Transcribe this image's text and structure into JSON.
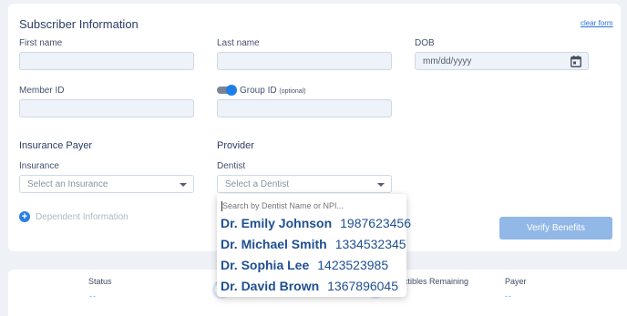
{
  "form": {
    "title": "Subscriber Information",
    "clear_label": "clear form",
    "first_name": {
      "label": "First name",
      "value": ""
    },
    "last_name": {
      "label": "Last name",
      "value": ""
    },
    "dob": {
      "label": "DOB",
      "placeholder": "mm/dd/yyyy"
    },
    "member_id": {
      "label": "Member ID",
      "value": ""
    },
    "group_id": {
      "label": "Group ID",
      "optional": "(optional)",
      "toggle_on": true
    },
    "insurance_payer": {
      "title": "Insurance Payer",
      "label": "Insurance",
      "placeholder": "Select an Insurance"
    },
    "provider": {
      "title": "Provider",
      "label": "Dentist",
      "placeholder": "Select a Dentist"
    },
    "dependent_label": "Dependent Information",
    "verify_label": "Verify Benefits"
  },
  "dentist_dropdown": {
    "search_placeholder": "Search by Dentist Name or NPI...",
    "options": [
      {
        "name": "Dr. Emily Johnson",
        "npi": "1987623456"
      },
      {
        "name": "Dr. Michael Smith",
        "npi": "1334532345"
      },
      {
        "name": "Dr. Sophia Lee",
        "npi": "1423523985"
      },
      {
        "name": "Dr. David Brown",
        "npi": "1367896045"
      }
    ]
  },
  "status_bar": {
    "status": {
      "label": "Status",
      "value": "--"
    },
    "col2": {
      "value": "--"
    },
    "deductibles": {
      "label": "ductibles Remaining",
      "value": "--"
    },
    "payer": {
      "label": "Payer",
      "value": "--"
    }
  },
  "icons": {
    "calendar": "calendar-icon",
    "plus": "plus-circle-icon",
    "caret": "chevron-down-icon"
  },
  "colors": {
    "accent": "#1c7fe6",
    "button": "#92b8e8",
    "link": "#2a6fdb"
  }
}
